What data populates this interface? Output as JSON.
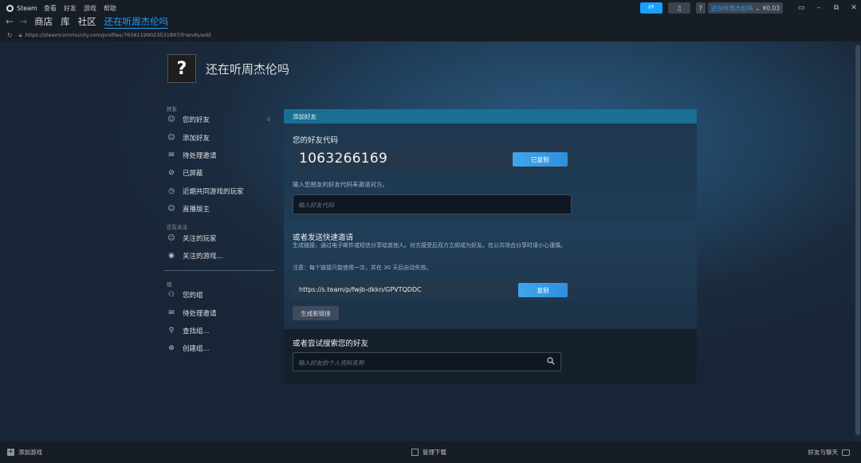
{
  "titlebar": {
    "app_name": "Steam",
    "menu": [
      "查看",
      "好友",
      "游戏",
      "帮助"
    ],
    "help_label": "?",
    "account_name": "还在听周杰伦吗",
    "account_caret": "⌄",
    "wallet_balance": "¥0.03"
  },
  "nav": {
    "tabs": [
      "商店",
      "库",
      "社区",
      "还在听周杰伦吗"
    ],
    "active_tab_index": 3,
    "url": "https://steamcommunity.com/profiles/76561199023531897/friends/add"
  },
  "profile": {
    "avatar_glyph": "?",
    "name": "还在听周杰伦吗"
  },
  "sidebar": {
    "friends_heading": "好友",
    "friends_items": [
      {
        "icon": "person-icon",
        "label": "您的好友",
        "count": "0"
      },
      {
        "icon": "add-person-icon",
        "label": "添加好友"
      },
      {
        "icon": "envelope-icon",
        "label": "待处理邀请"
      },
      {
        "icon": "blocked-icon",
        "label": "已屏蔽"
      },
      {
        "icon": "clock-icon",
        "label": "近期共同游戏的玩家"
      },
      {
        "icon": "broadcaster-icon",
        "label": "直播版主"
      }
    ],
    "following_heading": "正在关注",
    "following_items": [
      {
        "icon": "followed-players-icon",
        "label": "关注的玩家"
      },
      {
        "icon": "followed-games-icon",
        "label": "关注的游戏..."
      }
    ],
    "groups_heading": "组",
    "groups_items": [
      {
        "icon": "groups-icon",
        "label": "您的组"
      },
      {
        "icon": "envelope-icon",
        "label": "待处理邀请"
      },
      {
        "icon": "magnifier-icon",
        "label": "查找组..."
      },
      {
        "icon": "plus-circle-icon",
        "label": "创建组..."
      }
    ]
  },
  "panel": {
    "header": "添加好友",
    "friend_code": {
      "title": "您的好友代码",
      "code": "1063266169",
      "copied_button": "已复制",
      "hint": "输入您朋友的好友代码来邀请对方。",
      "input_placeholder": "输入好友代码"
    },
    "quick_invite": {
      "title": "或者发送快速邀请",
      "description": "生成链接，通过电子邮件或短信分享给其他人。对方接受后双方立即成为好友。在公共场合分享时请小心谨慎。",
      "note": "注意：每个链接只能使用一次，并在 30 天后自动失效。",
      "link": "https://s.team/p/fwjb-dkkn/GPVTQDDC",
      "copy_button": "复制",
      "generate_button": "生成新链接"
    },
    "search": {
      "title": "或者尝试搜索您的好友",
      "input_placeholder": "输入好友的个人资料名称"
    }
  },
  "bottombar": {
    "add_game": "添加游戏",
    "manage_downloads": "管理下载",
    "friends_chat": "好友与聊天"
  },
  "colors": {
    "accent_blue": "#1a9fff",
    "panel_header": "#1a6f95",
    "background": "#1b2838"
  }
}
